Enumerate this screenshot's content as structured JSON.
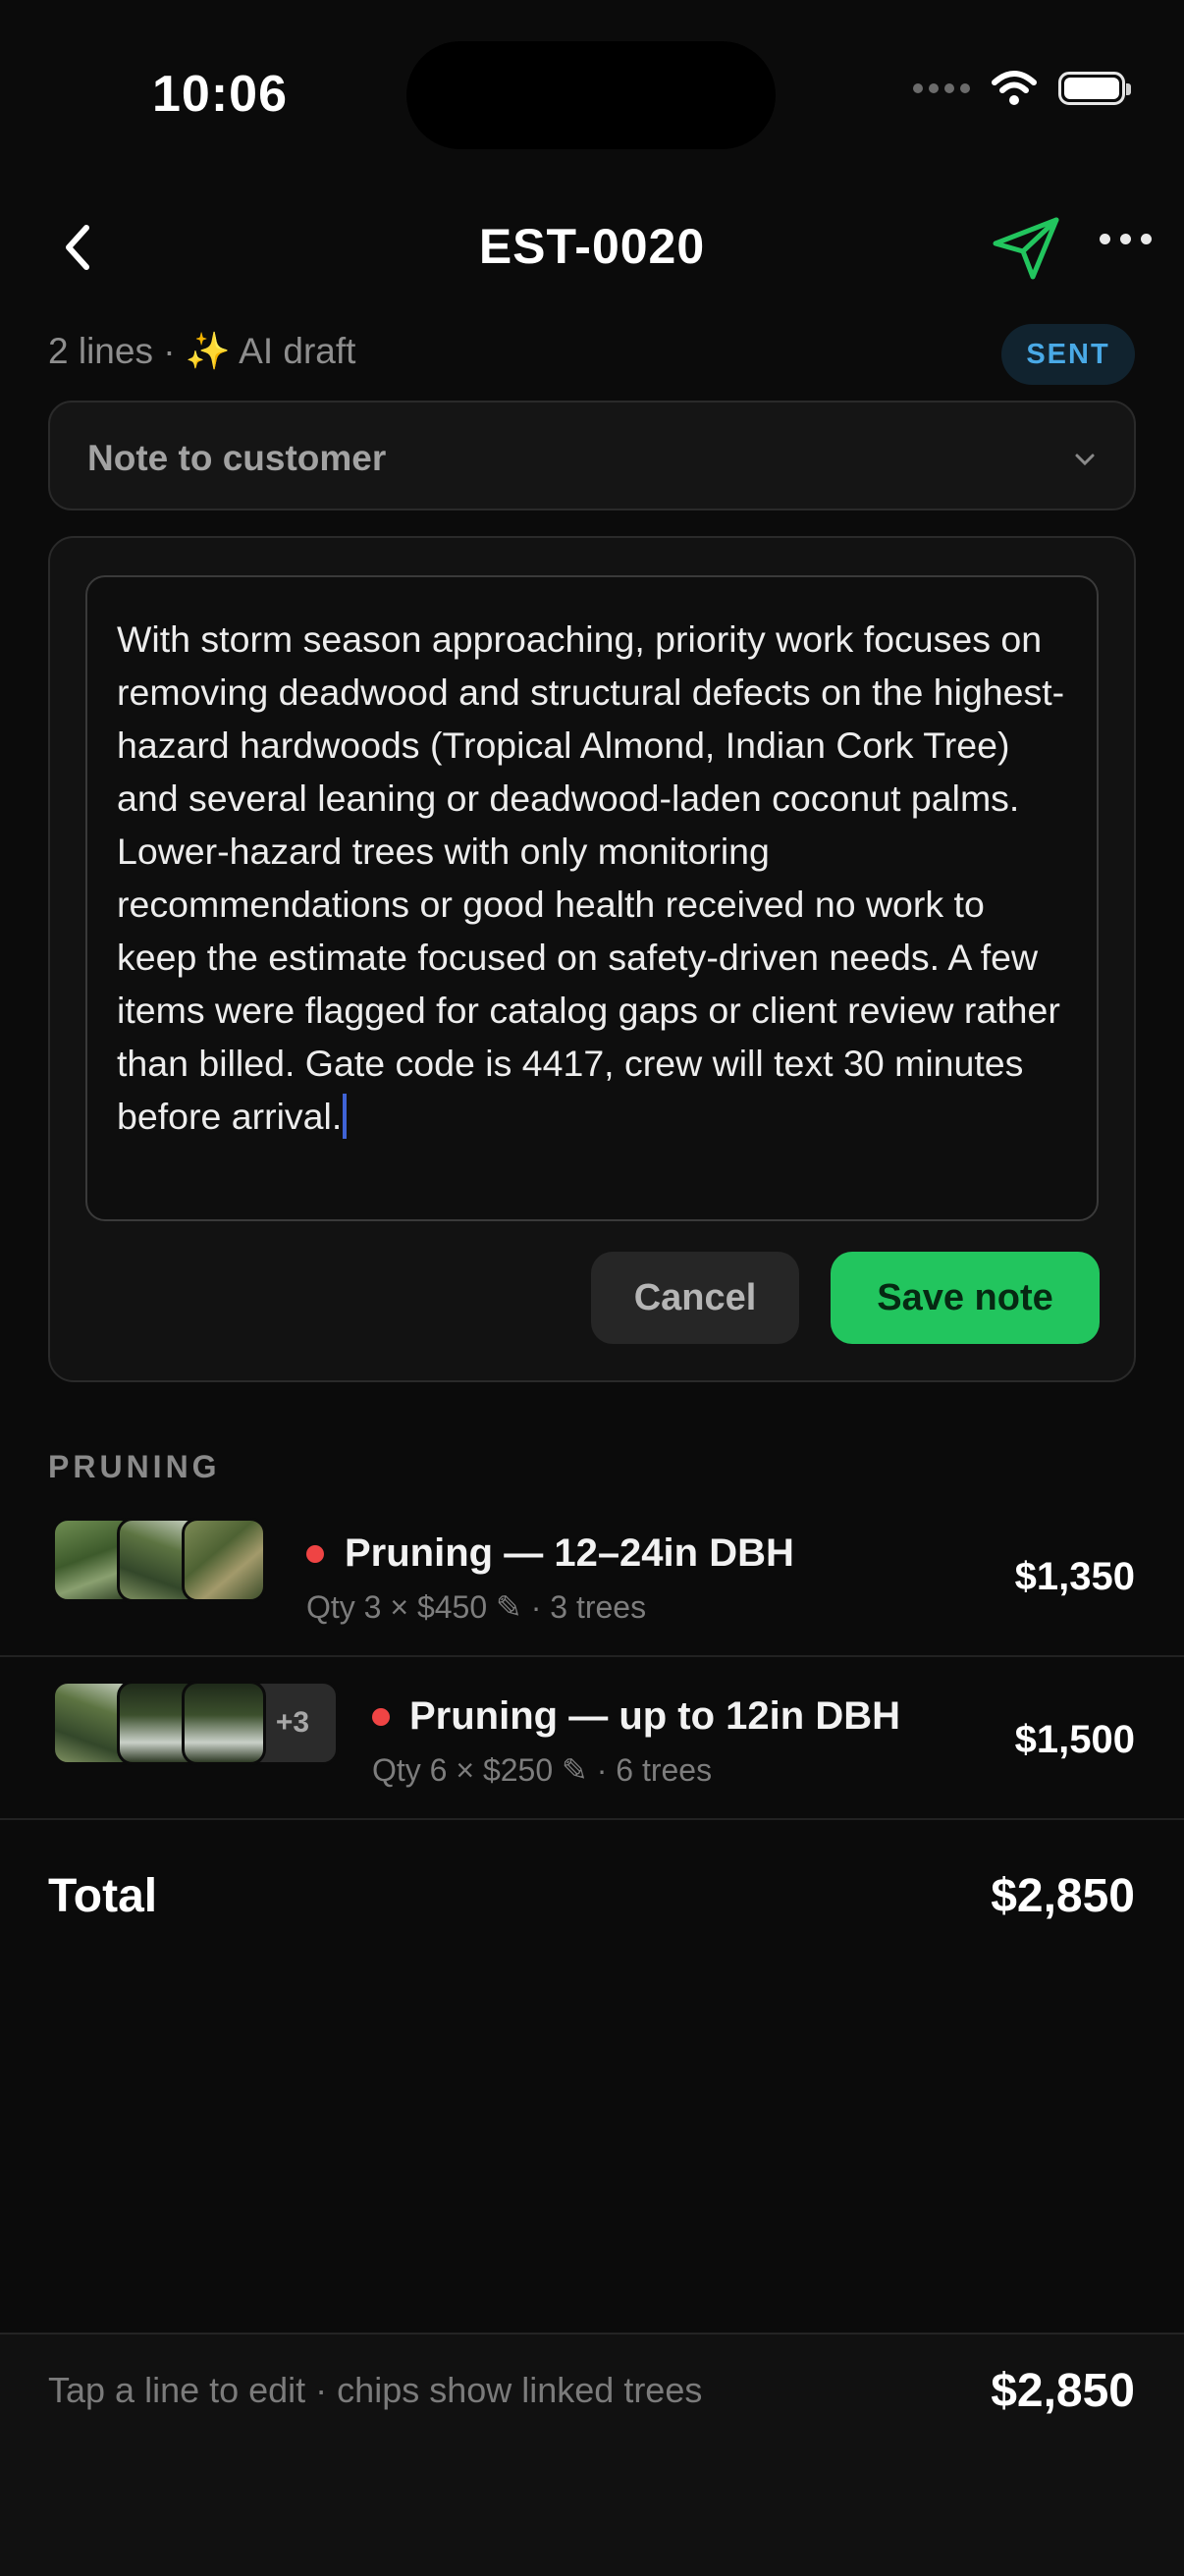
{
  "status_bar": {
    "time": "10:06"
  },
  "header": {
    "title": "EST-0020"
  },
  "meta": {
    "line_count": "2 lines",
    "separator": "·",
    "ai_label": "✨ AI draft",
    "status_badge": "SENT"
  },
  "note_dropdown": {
    "label": "Note to customer"
  },
  "note_editor": {
    "text": "With storm season approaching, priority work focuses on removing deadwood and structural defects on the highest-hazard hardwoods (Tropical Almond, Indian Cork Tree) and several leaning or deadwood-laden coconut palms. Lower-hazard trees with only monitoring recommendations or good health received no work to keep the estimate focused on safety-driven needs. A few items were flagged for catalog gaps or client review rather than billed. Gate code is 4417, crew will text 30 minutes before arrival.",
    "cancel_label": "Cancel",
    "save_label": "Save note"
  },
  "section": {
    "title": "PRUNING"
  },
  "line_items": [
    {
      "title": "Pruning — 12–24in DBH",
      "qty": "Qty 3 × $450",
      "trees": "3 trees",
      "price": "$1,350",
      "extra_photos": ""
    },
    {
      "title": "Pruning — up to 12in DBH",
      "qty": "Qty 6 × $250",
      "trees": "6 trees",
      "price": "$1,500",
      "extra_photos": "+3"
    }
  ],
  "total": {
    "label": "Total",
    "value": "$2,850"
  },
  "footer": {
    "hint": "Tap a line to edit · chips show linked trees",
    "total": "$2,850"
  },
  "colors": {
    "accent": "#22c55e",
    "badge_text": "#49a9e6",
    "status_dot": "#ef4444",
    "caret": "#3f63d6"
  },
  "icons": {
    "back": "chevron-left-icon",
    "send": "paper-plane-icon",
    "more": "ellipsis-icon",
    "dropdown": "chevron-down-icon",
    "edit": "pencil-icon"
  }
}
